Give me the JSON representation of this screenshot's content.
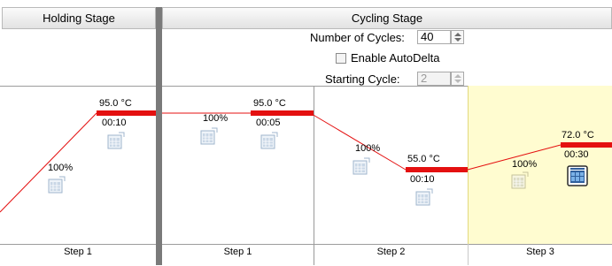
{
  "stages": {
    "holding": {
      "title": "Holding Stage"
    },
    "cycling": {
      "title": "Cycling Stage",
      "cycles_label": "Number of Cycles:",
      "cycles_value": "40",
      "autodelta_label": "Enable AutoDelta",
      "autodelta_checked": false,
      "starting_cycle_label": "Starting Cycle:",
      "starting_cycle_value": "2"
    }
  },
  "steps": [
    {
      "label": "Step 1",
      "temperature": "95.0 °C",
      "time": "00:10",
      "ramp": "100%"
    },
    {
      "label": "Step 1",
      "temperature": "95.0 °C",
      "time": "00:05",
      "ramp": "100%"
    },
    {
      "label": "Step 2",
      "temperature": "55.0 °C",
      "time": "00:10",
      "ramp": "100%"
    },
    {
      "label": "Step 3",
      "temperature": "72.0 °C",
      "time": "00:30",
      "ramp": "100%"
    }
  ],
  "colors": {
    "profile": "#e41010",
    "selected_step_bg": "#fffcd0",
    "stage_separator": "#7a7a7a"
  },
  "icons": {
    "data_collection": "data-collection-icon",
    "data_collection_selected": "data-collection-on-icon"
  }
}
